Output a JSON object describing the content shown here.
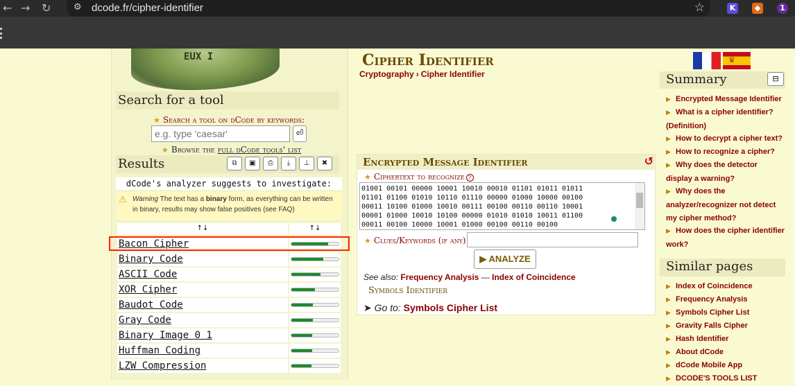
{
  "browser": {
    "url": "dcode.fr/cipher-identifier",
    "extension_badge": "1",
    "icons": [
      "back-icon",
      "forward-icon",
      "reload-icon",
      "tune-icon",
      "bookmark-star-icon"
    ]
  },
  "left": {
    "banner_letters": "EUX I",
    "search_title": "Search for a tool",
    "search_keywords_label": "Search a tool on dCode by keywords:",
    "search_placeholder": "e.g. type 'caesar'",
    "search_go": "⏎",
    "browse_prefix": "Browse the ",
    "browse_link": "full dCode tools' list",
    "results_title": "Results",
    "suggest": "dCode's analyzer suggests to investigate:",
    "warning_prefix": "Warning",
    "warning_text_a": " The text has a ",
    "warning_bold": "binary",
    "warning_text_b": " form, as everything can be written in binary, results may show false positives (see FAQ)",
    "sort_label_1": "↑↓",
    "sort_label_2": "↑↓",
    "results": [
      {
        "name": "Bacon Cipher",
        "score": 0.78
      },
      {
        "name": "Binary Code",
        "score": 0.68
      },
      {
        "name": "ASCII Code",
        "score": 0.62
      },
      {
        "name": "XOR Cipher",
        "score": 0.5
      },
      {
        "name": "Baudot Code",
        "score": 0.46
      },
      {
        "name": "Gray Code",
        "score": 0.46
      },
      {
        "name": "Binary Image 0 1",
        "score": 0.44
      },
      {
        "name": "Huffman Coding",
        "score": 0.44
      },
      {
        "name": "LZW Compression",
        "score": 0.42
      }
    ]
  },
  "main": {
    "title": "Cipher Identifier",
    "breadcrumb": [
      "Cryptography",
      "Cipher Identifier"
    ],
    "breadcrumb_sep": "›",
    "panel_title": "Encrypted Message Identifier",
    "ciphertext_label": "Ciphertext to recognize",
    "help": "?",
    "ciphertext": "01001 00101 00000 10001 10010 00010 01101 01011 01011\n01101 01100 01010 10110 01110 00000 01000 10000 00100\n00011 10100 01000 10010 00111 00100 00110 00110 10001\n00001 01000 10010 10100 00000 01010 01010 10011 01100\n00011 00100 10000 10001 01000 00100 00110 00100",
    "clues_label": "Clues/Keywords (if any)",
    "analyze": "▶ ANALYZE",
    "see_also_label": "See also:",
    "see_also_1": "Frequency Analysis",
    "see_also_sep": " — ",
    "see_also_2": "Index of Coincidence",
    "symbols_identifier": "Symbols Identifier",
    "goto_arrow": "➤",
    "goto_label": "Go to:",
    "goto_link": "Symbols Cipher List"
  },
  "right": {
    "summary_title": "Summary",
    "summary_toggle": "⊟",
    "summary_items": [
      "Encrypted Message Identifier",
      "What is a cipher identifier? (Definition)",
      "How to decrypt a cipher text?",
      "How to recognize a cipher?",
      "Why does the detector display a warning?",
      "Why does the analyzer/recognizer not detect my cipher method?",
      "How does the cipher identifier work?"
    ],
    "similar_title": "Similar pages",
    "similar_items": [
      "Index of Coincidence",
      "Frequency Analysis",
      "Symbols Cipher List",
      "Gravity Falls Cipher",
      "Hash Identifier",
      "About dCode",
      "dCode Mobile App",
      "DCODE'S TOOLS LIST"
    ]
  },
  "colors": {
    "accent": "#8b0000",
    "heading": "#6b4a00",
    "bar": "#1c8a2e",
    "highlight": "#ff2200",
    "background": "#fafad2"
  }
}
